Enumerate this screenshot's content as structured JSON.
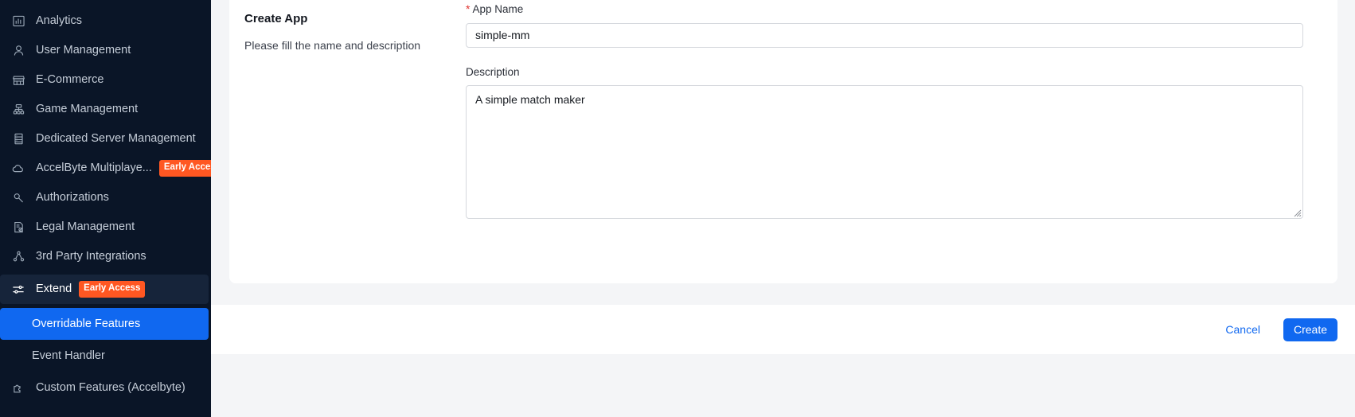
{
  "sidebar": {
    "items": [
      {
        "label": "Analytics",
        "icon": "bar-chart-icon",
        "badge": null
      },
      {
        "label": "User Management",
        "icon": "user-icon",
        "badge": null
      },
      {
        "label": "E-Commerce",
        "icon": "store-icon",
        "badge": null
      },
      {
        "label": "Game Management",
        "icon": "sitemap-icon",
        "badge": null
      },
      {
        "label": "Dedicated Server Management",
        "icon": "server-icon",
        "badge": null
      },
      {
        "label": "AccelByte Multiplaye...",
        "icon": "cloud-icon",
        "badge": "Early Access"
      },
      {
        "label": "Authorizations",
        "icon": "key-icon",
        "badge": null
      },
      {
        "label": "Legal Management",
        "icon": "document-check-icon",
        "badge": null
      },
      {
        "label": "3rd Party Integrations",
        "icon": "share-nodes-icon",
        "badge": null
      }
    ],
    "extend": {
      "label": "Extend",
      "icon": "sliders-icon",
      "badge": "Early Access"
    },
    "sub_items": [
      {
        "label": "Overridable Features",
        "selected": true
      },
      {
        "label": "Event Handler",
        "selected": false
      }
    ],
    "cutoff_item": {
      "label": "Custom Features (Accelbyte)",
      "icon": "puzzle-icon"
    },
    "colors": {
      "background": "#0a1527",
      "active_group": "#16243a",
      "selected": "#1068f0",
      "badge": "#ff5722",
      "text": "#c5cdd8"
    }
  },
  "form": {
    "title": "Create App",
    "subtitle": "Please fill the name and description",
    "app_name": {
      "label": "App Name",
      "required_marker": "*",
      "value": "simple-mm",
      "placeholder": "App Name"
    },
    "description": {
      "label": "Description",
      "value": "A simple match maker",
      "placeholder": "Description"
    }
  },
  "footer": {
    "cancel_label": "Cancel",
    "create_label": "Create",
    "accent_color": "#1068f0"
  }
}
